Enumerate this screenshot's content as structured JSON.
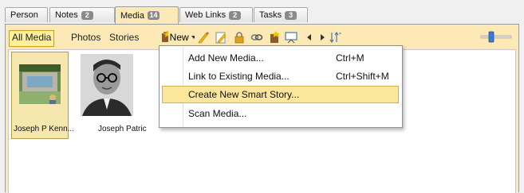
{
  "tabs": [
    {
      "label": "Person",
      "badge": ""
    },
    {
      "label": "Notes",
      "badge": "2"
    },
    {
      "label": "Media",
      "badge": "14"
    },
    {
      "label": "Web Links",
      "badge": "2"
    },
    {
      "label": "Tasks",
      "badge": "3"
    }
  ],
  "active_tab": "Media",
  "filters": {
    "all": "All Media",
    "photos": "Photos",
    "stories": "Stories"
  },
  "toolbar": {
    "new_label": "New"
  },
  "media": [
    {
      "caption": "Joseph P Kenn..."
    },
    {
      "caption": "Joseph Patric"
    }
  ],
  "menu": {
    "items": [
      {
        "label": "Add New Media...",
        "shortcut": "Ctrl+M"
      },
      {
        "label": "Link to Existing Media...",
        "shortcut": "Ctrl+Shift+M"
      },
      {
        "label": "Create New Smart Story...",
        "shortcut": ""
      },
      {
        "label": "Scan Media...",
        "shortcut": ""
      }
    ],
    "highlighted": "Create New Smart Story..."
  },
  "colors": {
    "accent": "#fce9b6",
    "highlight": "#fbe69c",
    "filter_active": "#fff099",
    "badge": "#8a8a8a"
  }
}
